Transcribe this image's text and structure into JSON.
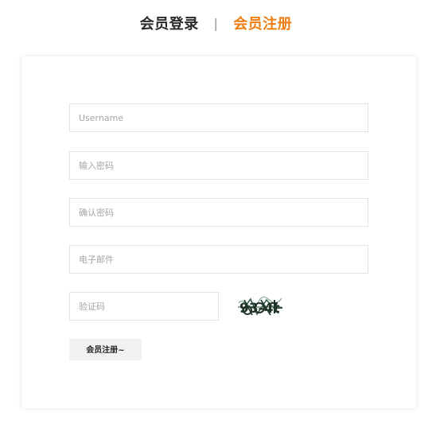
{
  "tabs": {
    "login_label": "会员登录",
    "separator": "|",
    "register_label": "会员注册",
    "active": "register"
  },
  "form": {
    "username_placeholder": "Username",
    "password_placeholder": "输入密码",
    "confirm_password_placeholder": "确认密码",
    "email_placeholder": "电子邮件",
    "captcha_placeholder": "验证码",
    "captcha_text": "93-4t",
    "submit_label": "会员注册~"
  },
  "colors": {
    "active_tab": "#ee7d12",
    "inactive_tab": "#2a2a2a",
    "field_border": "#e3e3e3",
    "button_bg": "#f2f2f2"
  }
}
